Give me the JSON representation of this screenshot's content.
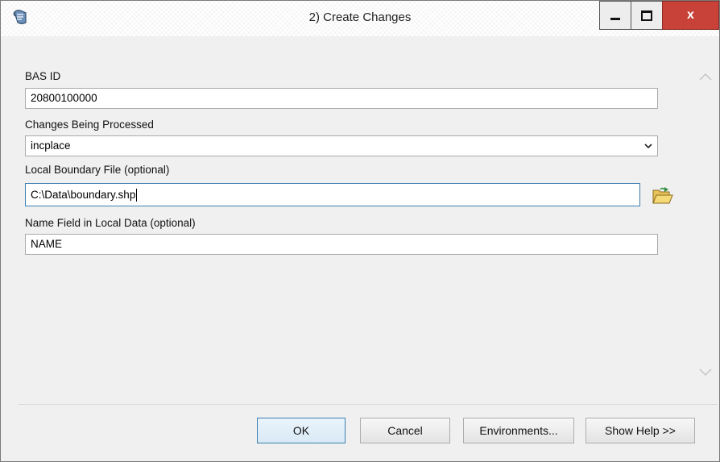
{
  "window": {
    "title": "2) Create Changes"
  },
  "titlebar_controls": {
    "minimize_icon": "minimize-icon",
    "maximize_icon": "maximize-icon",
    "close_label": "x"
  },
  "form": {
    "bas_id": {
      "label": "BAS ID",
      "value": "20800100000"
    },
    "changes": {
      "label": "Changes Being Processed",
      "value": "incplace",
      "icon": "chevron-down-icon"
    },
    "boundary": {
      "label": "Local Boundary File (optional)",
      "value": "C:\\Data\\boundary.shp",
      "icon": "folder-open-icon"
    },
    "name_field": {
      "label": "Name Field in Local Data (optional)",
      "value": "NAME"
    }
  },
  "buttons": {
    "ok": "OK",
    "cancel": "Cancel",
    "environments": "Environments...",
    "show_help": "Show Help >>"
  },
  "colors": {
    "close_button": "#c9423a",
    "focus_border": "#3c7fb1",
    "dialog_bg": "#f0f0f0"
  }
}
